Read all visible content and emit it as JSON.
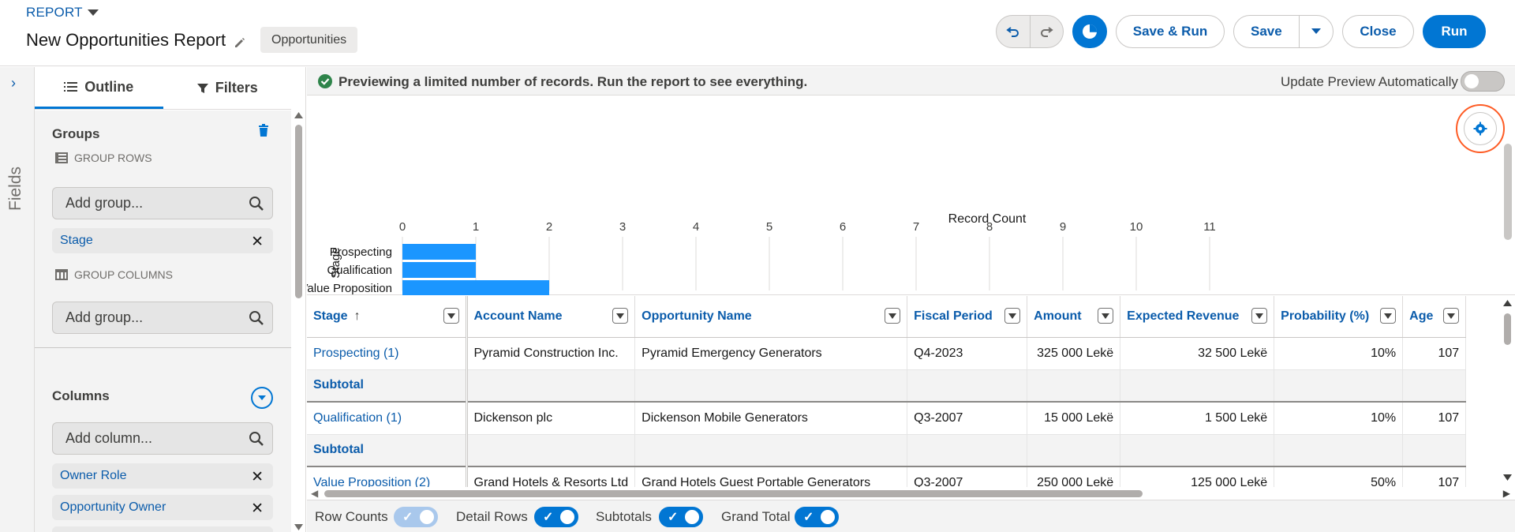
{
  "header": {
    "report_label": "REPORT",
    "title": "New Opportunities Report",
    "type_badge": "Opportunities",
    "buttons": {
      "save_run": "Save & Run",
      "save": "Save",
      "close": "Close",
      "run": "Run"
    },
    "icons": [
      "undo-icon",
      "redo-icon",
      "chart-icon",
      "chevron-down-icon",
      "pencil-icon"
    ]
  },
  "fields_rail": {
    "label": "Fields"
  },
  "left_panel": {
    "tabs": [
      {
        "label": "Outline",
        "icon": "list-icon",
        "active": true
      },
      {
        "label": "Filters",
        "icon": "filter-icon",
        "active": false
      }
    ],
    "groups": {
      "title": "Groups",
      "group_rows_label": "GROUP ROWS",
      "group_rows_placeholder": "Add group...",
      "group_rows": [
        "Stage"
      ],
      "group_columns_label": "GROUP COLUMNS",
      "group_columns_placeholder": "Add group..."
    },
    "columns": {
      "title": "Columns",
      "placeholder": "Add column...",
      "items": [
        "Owner Role",
        "Opportunity Owner"
      ]
    }
  },
  "preview": {
    "message": "Previewing a limited number of records. Run the report to see everything.",
    "auto_label": "Update Preview Automatically",
    "auto_enabled": false
  },
  "chart_data": {
    "type": "bar",
    "orientation": "horizontal",
    "title": "Record Count",
    "ylabel": "Stage",
    "categories": [
      "Prospecting",
      "Qualification",
      "Value Proposition"
    ],
    "values": [
      1,
      1,
      2
    ],
    "xlim": [
      0,
      11
    ],
    "xticks": [
      "0",
      "1",
      "2",
      "3",
      "4",
      "5",
      "6",
      "7",
      "8",
      "9",
      "10",
      "11"
    ],
    "grid": true,
    "color": "#1b96ff"
  },
  "table": {
    "columns": [
      "Stage",
      "Account Name",
      "Opportunity Name",
      "Fiscal Period",
      "Amount",
      "Expected Revenue",
      "Probability (%)",
      "Age"
    ],
    "rows": [
      {
        "kind": "data",
        "cells": [
          "Prospecting (1)",
          "Pyramid Construction Inc.",
          "Pyramid Emergency Generators",
          "Q4-2023",
          "325 000 Lekë",
          "32 500 Lekë",
          "10%",
          "107"
        ]
      },
      {
        "kind": "subtotal",
        "cells": [
          "Subtotal",
          "",
          "",
          "",
          "",
          "",
          "",
          ""
        ]
      },
      {
        "kind": "data",
        "cells": [
          "Qualification (1)",
          "Dickenson plc",
          "Dickenson Mobile Generators",
          "Q3-2007",
          "15 000 Lekë",
          "1 500 Lekë",
          "10%",
          "107"
        ]
      },
      {
        "kind": "subtotal",
        "cells": [
          "Subtotal",
          "",
          "",
          "",
          "",
          "",
          "",
          ""
        ]
      },
      {
        "kind": "data",
        "cells": [
          "Value Proposition (2)",
          "Grand Hotels & Resorts Ltd",
          "Grand Hotels Guest Portable Generators",
          "Q3-2007",
          "250 000 Lekë",
          "125 000 Lekë",
          "50%",
          "107"
        ]
      }
    ]
  },
  "footer": {
    "row_counts": "Row Counts",
    "detail_rows": "Detail Rows",
    "subtotals": "Subtotals",
    "grand_total": "Grand Total"
  },
  "colors": {
    "brand": "#0176d3",
    "link": "#0b5cab",
    "bar": "#1b96ff",
    "highlight": "#fe5c25",
    "success": "#2e844a"
  }
}
